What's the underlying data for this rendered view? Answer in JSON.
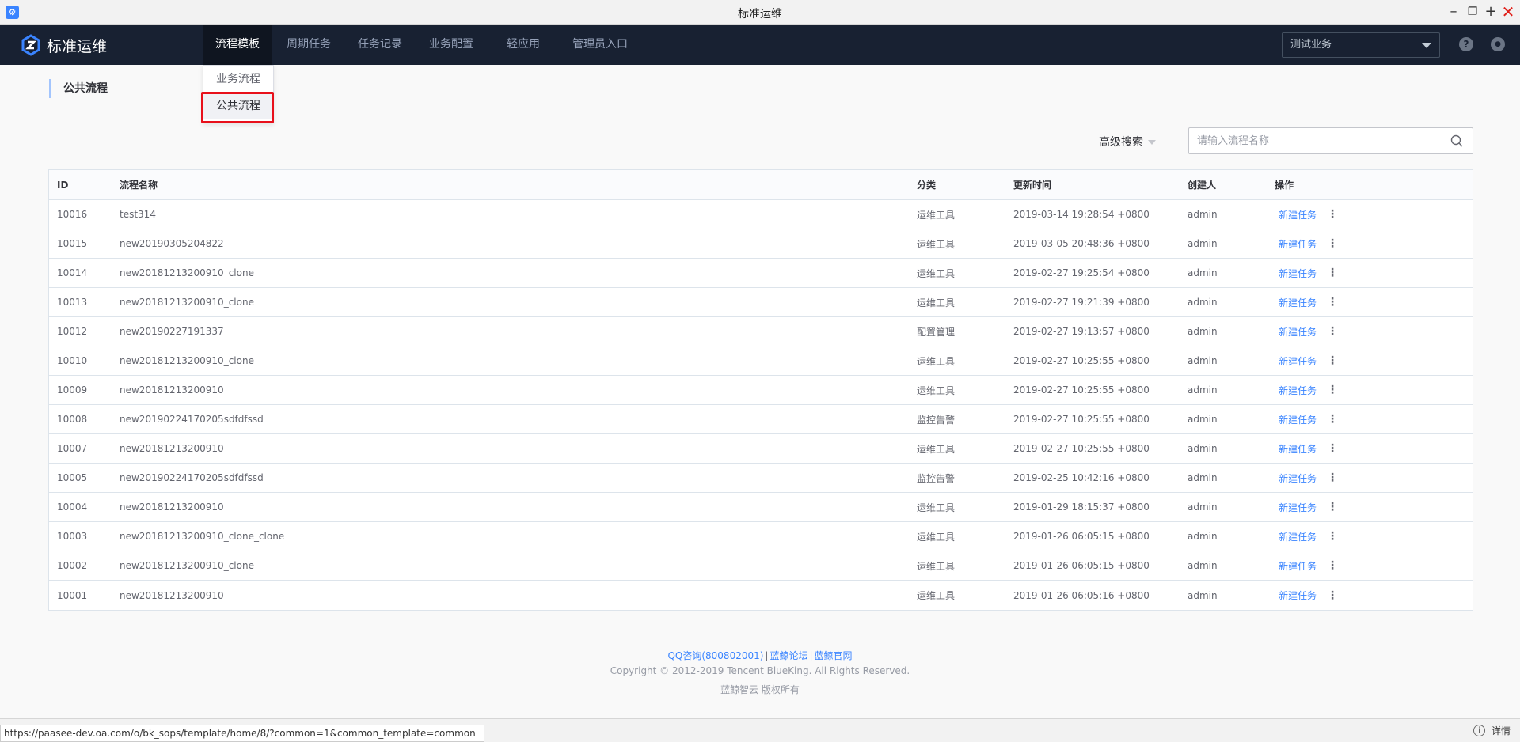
{
  "window": {
    "title": "标准运维"
  },
  "nav": {
    "logo_text": "标准运维",
    "items": [
      "流程模板",
      "周期任务",
      "任务记录",
      "业务配置",
      "轻应用",
      "管理员入口"
    ],
    "business_select": "测试业务",
    "help_icon_glyph": "?",
    "user_icon_glyph": "●"
  },
  "dropdown": {
    "items": [
      "业务流程",
      "公共流程"
    ]
  },
  "page": {
    "title": "公共流程"
  },
  "search": {
    "advanced_label": "高级搜索",
    "placeholder": "请输入流程名称"
  },
  "table": {
    "headers": {
      "id": "ID",
      "name": "流程名称",
      "category": "分类",
      "updated": "更新时间",
      "creator": "创建人",
      "actions": "操作"
    },
    "action_label": "新建任务",
    "more_glyph": "⋮",
    "rows": [
      {
        "id": "10016",
        "name": "test314",
        "category": "运维工具",
        "updated": "2019-03-14 19:28:54 +0800",
        "creator": "admin"
      },
      {
        "id": "10015",
        "name": "new20190305204822",
        "category": "运维工具",
        "updated": "2019-03-05 20:48:36 +0800",
        "creator": "admin"
      },
      {
        "id": "10014",
        "name": "new20181213200910_clone",
        "category": "运维工具",
        "updated": "2019-02-27 19:25:54 +0800",
        "creator": "admin"
      },
      {
        "id": "10013",
        "name": "new20181213200910_clone",
        "category": "运维工具",
        "updated": "2019-02-27 19:21:39 +0800",
        "creator": "admin"
      },
      {
        "id": "10012",
        "name": "new20190227191337",
        "category": "配置管理",
        "updated": "2019-02-27 19:13:57 +0800",
        "creator": "admin"
      },
      {
        "id": "10010",
        "name": "new20181213200910_clone",
        "category": "运维工具",
        "updated": "2019-02-27 10:25:55 +0800",
        "creator": "admin"
      },
      {
        "id": "10009",
        "name": "new20181213200910",
        "category": "运维工具",
        "updated": "2019-02-27 10:25:55 +0800",
        "creator": "admin"
      },
      {
        "id": "10008",
        "name": "new20190224170205sdfdfssd",
        "category": "监控告警",
        "updated": "2019-02-27 10:25:55 +0800",
        "creator": "admin"
      },
      {
        "id": "10007",
        "name": "new20181213200910",
        "category": "运维工具",
        "updated": "2019-02-27 10:25:55 +0800",
        "creator": "admin"
      },
      {
        "id": "10005",
        "name": "new20190224170205sdfdfssd",
        "category": "监控告警",
        "updated": "2019-02-25 10:42:16 +0800",
        "creator": "admin"
      },
      {
        "id": "10004",
        "name": "new20181213200910",
        "category": "运维工具",
        "updated": "2019-01-29 18:15:37 +0800",
        "creator": "admin"
      },
      {
        "id": "10003",
        "name": "new20181213200910_clone_clone",
        "category": "运维工具",
        "updated": "2019-01-26 06:05:15 +0800",
        "creator": "admin"
      },
      {
        "id": "10002",
        "name": "new20181213200910_clone",
        "category": "运维工具",
        "updated": "2019-01-26 06:05:15 +0800",
        "creator": "admin"
      },
      {
        "id": "10001",
        "name": "new20181213200910",
        "category": "运维工具",
        "updated": "2019-01-26 06:05:16 +0800",
        "creator": "admin"
      }
    ]
  },
  "footer": {
    "links": [
      "QQ咨询(800802001)",
      "蓝鲸论坛",
      "蓝鲸官网"
    ],
    "separator": "|",
    "copyright": "Copyright © 2012-2019 Tencent BlueKing. All Rights Reserved.",
    "copyright_cn": "蓝鲸智云 版权所有"
  },
  "statusbar": {
    "url": "https://paasee-dev.oa.com/o/bk_sops/template/home/8/?common=1&common_template=common",
    "details_label": "详情"
  },
  "colors": {
    "nav_bg": "#182132",
    "accent": "#3a84ff",
    "highlight": "#e8101b"
  }
}
